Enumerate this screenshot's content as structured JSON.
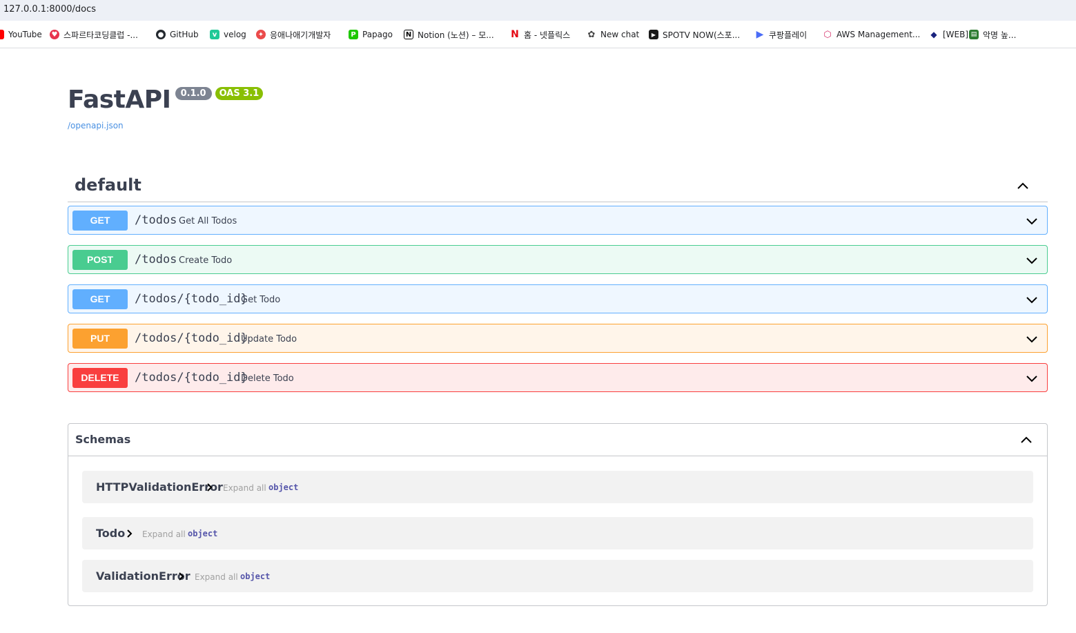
{
  "browser": {
    "url": "127.0.0.1:8000/docs",
    "bookmarks": [
      {
        "label": "YouTube",
        "icon": "youtube-icon",
        "color": "#ff0000"
      },
      {
        "label": "스파르타코딩클럽 -...",
        "icon": "sparta-icon",
        "color": "#e8344e"
      },
      {
        "label": "GitHub",
        "icon": "github-icon",
        "color": "#24292f"
      },
      {
        "label": "velog",
        "icon": "velog-icon",
        "color": "#20c997"
      },
      {
        "label": "응애나애기개발자",
        "icon": "tistory-icon",
        "color": "#eb4b4b"
      },
      {
        "label": "Papago",
        "icon": "papago-icon",
        "color": "#1ec800"
      },
      {
        "label": "Notion (노션) – 모...",
        "icon": "notion-icon",
        "color": "#000000"
      },
      {
        "label": "홈 - 넷플릭스",
        "icon": "netflix-icon",
        "color": "#e50914"
      },
      {
        "label": "New chat",
        "icon": "chatgpt-icon",
        "color": "#444444"
      },
      {
        "label": "SPOTV NOW(스포...",
        "icon": "spotv-icon",
        "color": "#1a1a1a"
      },
      {
        "label": "쿠팡플레이",
        "icon": "coupangplay-icon",
        "color": "#4a6cf7"
      },
      {
        "label": "AWS Management...",
        "icon": "aws-icon",
        "color": "#d6336c"
      },
      {
        "label": "[WEB]",
        "icon": "web-icon",
        "color": "#1a237e"
      },
      {
        "label": "악명 높...",
        "icon": "sheet-icon",
        "color": "#2e7d32"
      }
    ]
  },
  "info": {
    "title": "FastAPI",
    "version": "0.1.0",
    "oas": "OAS 3.1",
    "spec_link": "/openapi.json"
  },
  "tag": {
    "name": "default"
  },
  "operations": [
    {
      "method": "GET",
      "path": "/todos",
      "summary": "Get All Todos"
    },
    {
      "method": "POST",
      "path": "/todos",
      "summary": "Create Todo"
    },
    {
      "method": "GET",
      "path": "/todos/{todo_id}",
      "summary": "Get Todo"
    },
    {
      "method": "PUT",
      "path": "/todos/{todo_id}",
      "summary": "Update Todo"
    },
    {
      "method": "DELETE",
      "path": "/todos/{todo_id}",
      "summary": "Delete Todo"
    }
  ],
  "schemas": {
    "title": "Schemas",
    "expand_label": "Expand all",
    "models": [
      {
        "name": "HTTPValidationError",
        "type": "object"
      },
      {
        "name": "Todo",
        "type": "object"
      },
      {
        "name": "ValidationError",
        "type": "object"
      }
    ]
  },
  "colors": {
    "get": "#61affe",
    "post": "#49cc90",
    "put": "#fca130",
    "delete": "#f93e3e",
    "version_badge": "#7d8492",
    "oas_badge": "#89bf04"
  }
}
